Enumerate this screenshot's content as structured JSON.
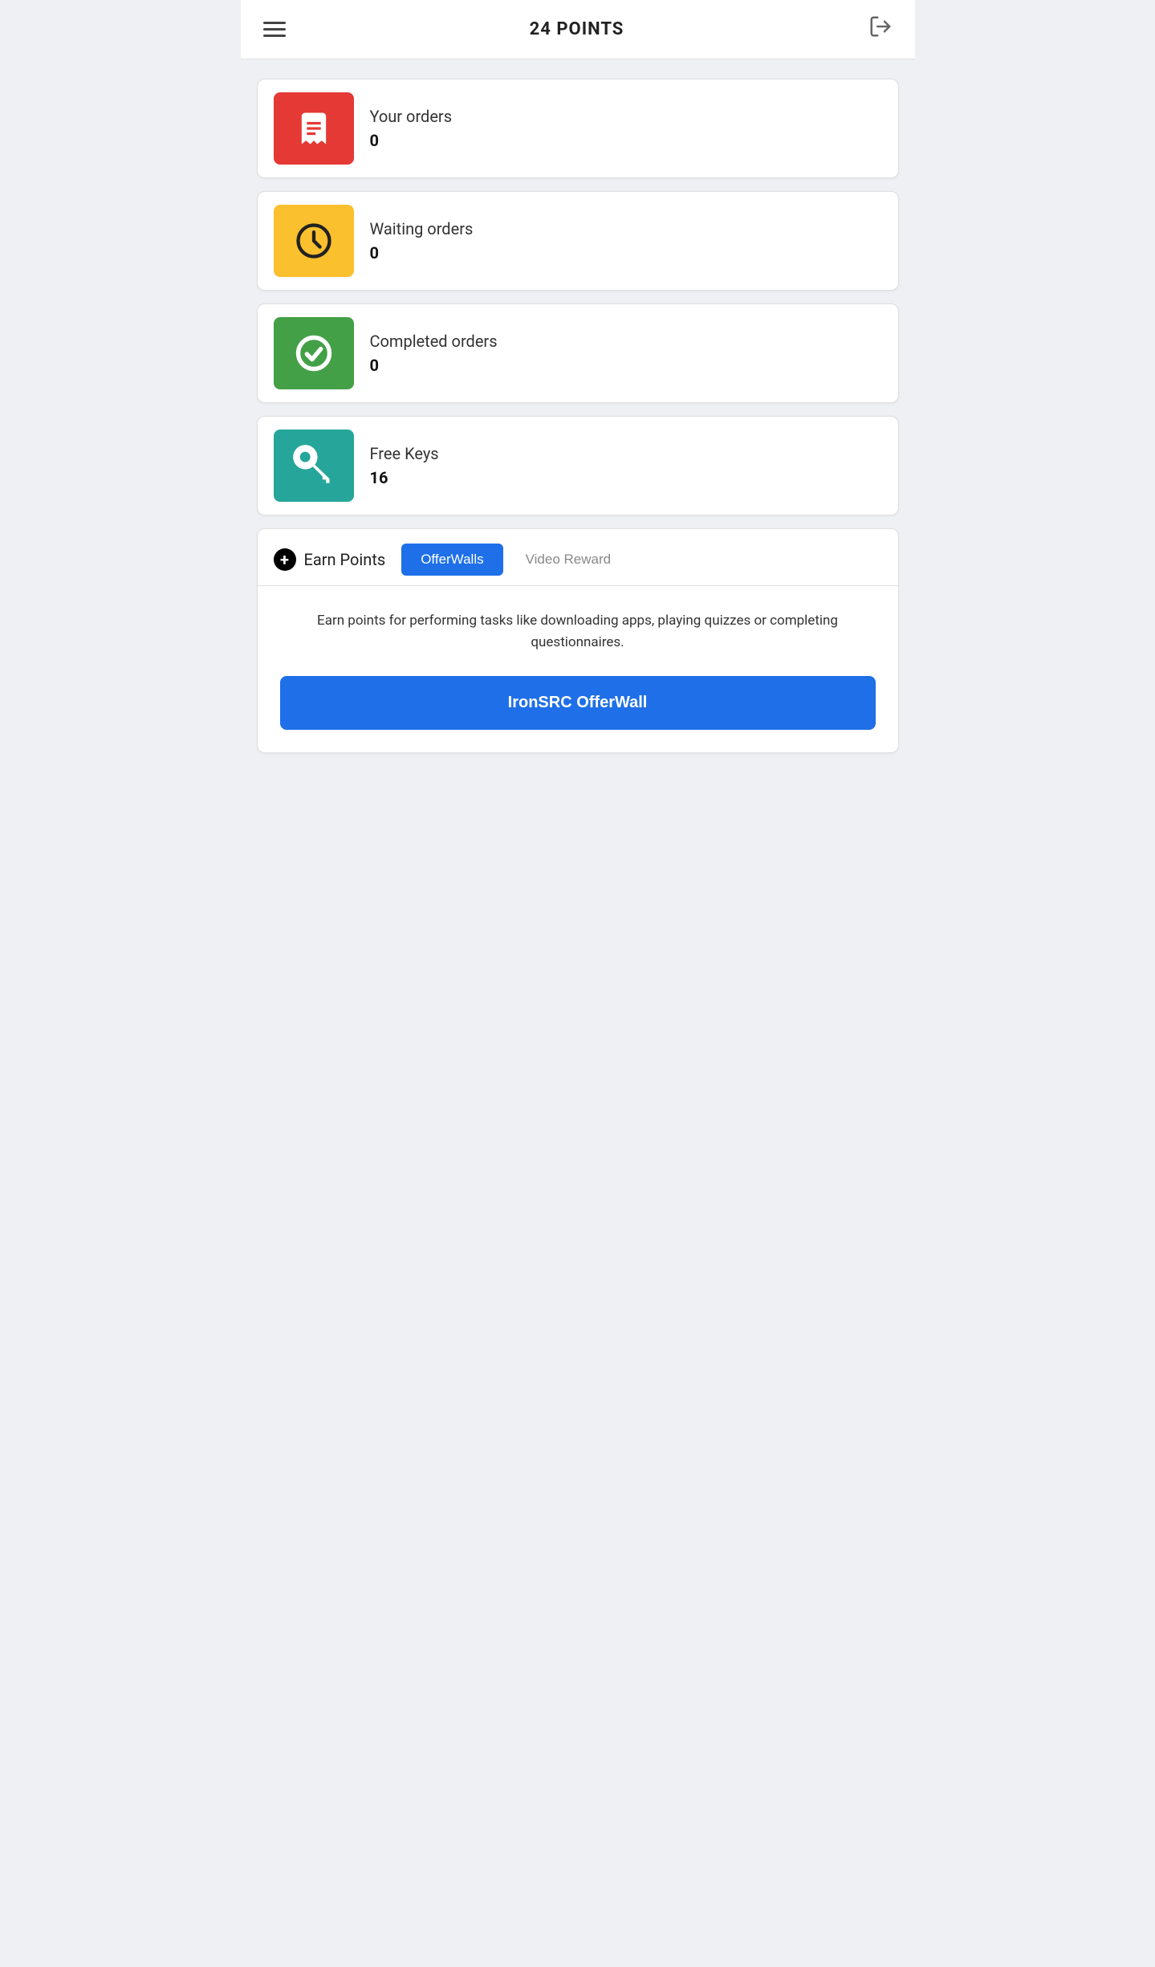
{
  "header": {
    "title": "24 POINTS",
    "menu_icon_label": "menu",
    "logout_icon_label": "logout"
  },
  "cards": [
    {
      "id": "your-orders",
      "label": "Your orders",
      "value": "0",
      "icon_type": "receipt",
      "color": "red"
    },
    {
      "id": "waiting-orders",
      "label": "Waiting orders",
      "value": "0",
      "icon_type": "clock",
      "color": "yellow"
    },
    {
      "id": "completed-orders",
      "label": "Completed orders",
      "value": "0",
      "icon_type": "check",
      "color": "green"
    },
    {
      "id": "free-keys",
      "label": "Free Keys",
      "value": "16",
      "icon_type": "key",
      "color": "teal"
    }
  ],
  "earn_section": {
    "title": "Earn Points",
    "tabs": [
      {
        "id": "offerwalls",
        "label": "OfferWalls",
        "active": true
      },
      {
        "id": "video-reward",
        "label": "Video Reward",
        "active": false
      }
    ],
    "description": "Earn points for performing tasks like downloading apps, playing quizzes or completing questionnaires.",
    "cta_button": "IronSRC OfferWall"
  }
}
